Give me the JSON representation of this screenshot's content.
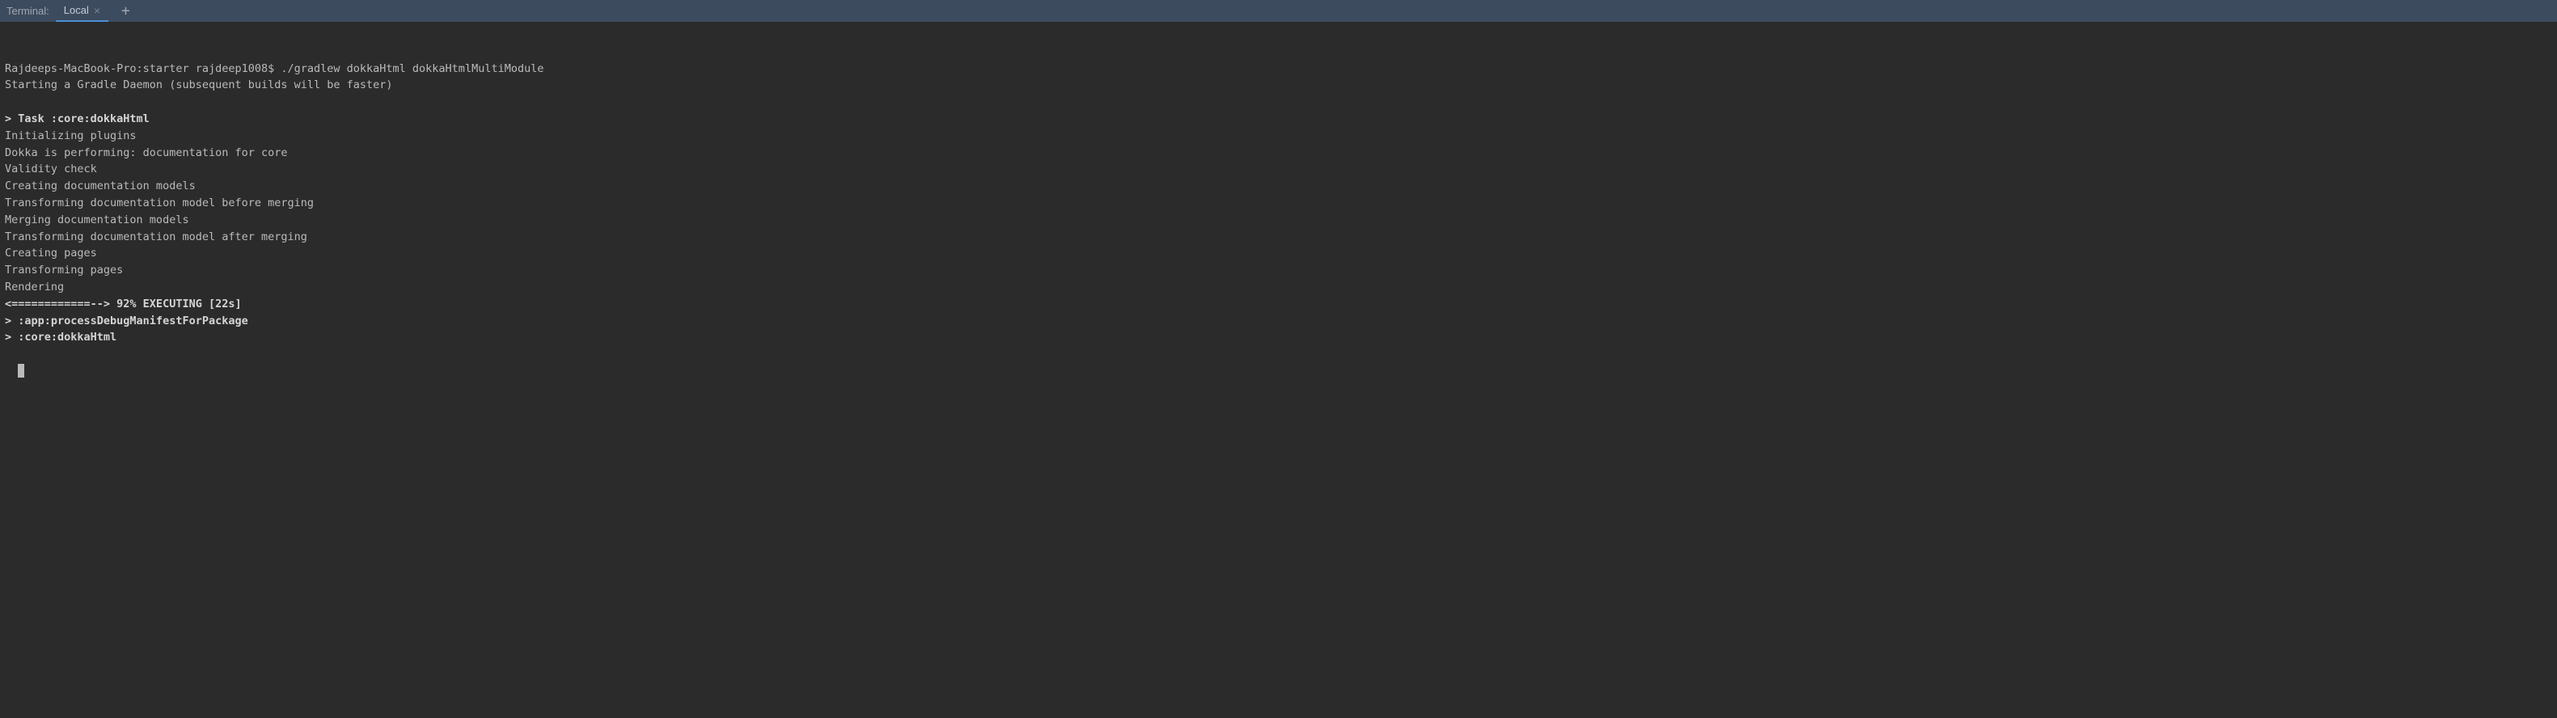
{
  "header": {
    "terminal_label": "Terminal:",
    "tab_label": "Local",
    "tab_close": "×",
    "add_tab": "+"
  },
  "terminal": {
    "lines": [
      {
        "type": "plain",
        "text": "Rajdeeps-MacBook-Pro:starter rajdeep1008$ ./gradlew dokkaHtml dokkaHtmlMultiModule"
      },
      {
        "type": "plain",
        "text": "Starting a Gradle Daemon (subsequent builds will be faster)"
      },
      {
        "type": "blank",
        "text": ""
      },
      {
        "type": "bold",
        "text": "> Task :core:dokkaHtml"
      },
      {
        "type": "plain",
        "text": "Initializing plugins"
      },
      {
        "type": "plain",
        "text": "Dokka is performing: documentation for core"
      },
      {
        "type": "plain",
        "text": "Validity check"
      },
      {
        "type": "plain",
        "text": "Creating documentation models"
      },
      {
        "type": "plain",
        "text": "Transforming documentation model before merging"
      },
      {
        "type": "plain",
        "text": "Merging documentation models"
      },
      {
        "type": "plain",
        "text": "Transforming documentation model after merging"
      },
      {
        "type": "plain",
        "text": "Creating pages"
      },
      {
        "type": "plain",
        "text": "Transforming pages"
      },
      {
        "type": "plain",
        "text": "Rendering"
      },
      {
        "type": "bold",
        "text": "<============--> 92% EXECUTING [22s]"
      },
      {
        "type": "bold",
        "text": "> :app:processDebugManifestForPackage"
      },
      {
        "type": "bold",
        "text": "> :core:dokkaHtml"
      }
    ]
  }
}
